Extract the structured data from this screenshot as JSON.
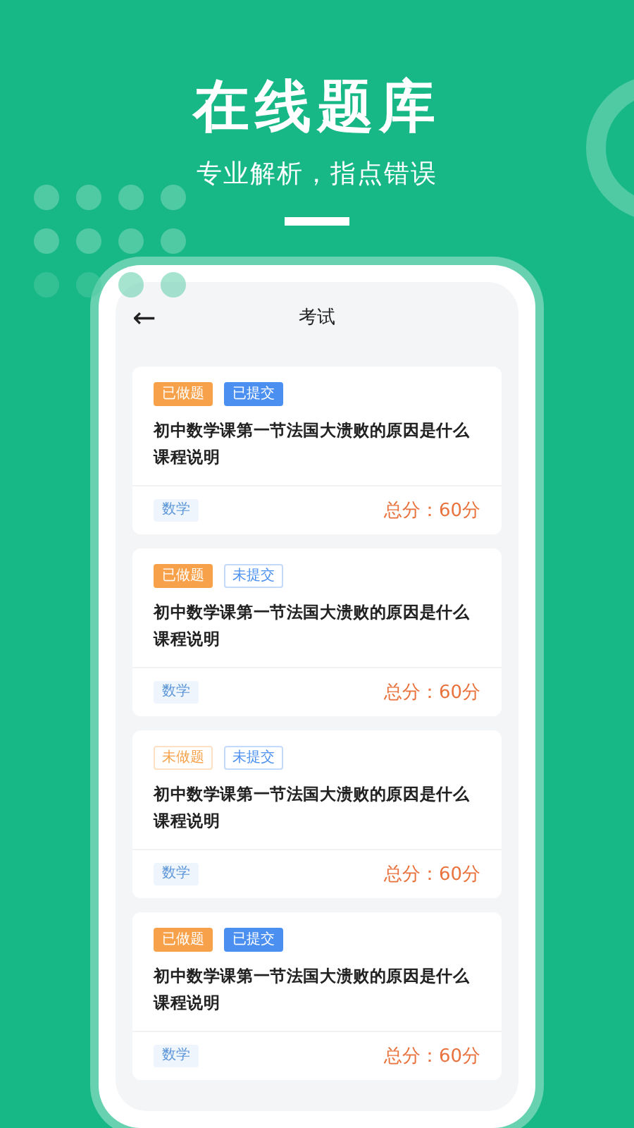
{
  "banner": {
    "title": "在线题库",
    "subtitle": "专业解析，指点错误"
  },
  "screen": {
    "header": {
      "back": "←",
      "title": "考试"
    },
    "cards": [
      {
        "tags": [
          {
            "label": "已做题",
            "color": "#f7a24b",
            "filled": true
          },
          {
            "label": "已提交",
            "color": "#4b90f0",
            "filled": true
          }
        ],
        "title": "初中数学课第一节法国大溃败的原因是什么",
        "description": "课程说明",
        "subject": "数学",
        "score": "总分：60分"
      },
      {
        "tags": [
          {
            "label": "已做题",
            "color": "#f7a24b",
            "filled": true
          },
          {
            "label": "未提交",
            "color": "#4b90f0",
            "filled": false
          }
        ],
        "title": "初中数学课第一节法国大溃败的原因是什么",
        "description": "课程说明",
        "subject": "数学",
        "score": "总分：60分"
      },
      {
        "tags": [
          {
            "label": "未做题",
            "color": "#f7a24b",
            "filled": false
          },
          {
            "label": "未提交",
            "color": "#4b90f0",
            "filled": false
          }
        ],
        "title": "初中数学课第一节法国大溃败的原因是什么",
        "description": "课程说明",
        "subject": "数学",
        "score": "总分：60分"
      },
      {
        "tags": [
          {
            "label": "已做题",
            "color": "#f7a24b",
            "filled": true
          },
          {
            "label": "已提交",
            "color": "#4b90f0",
            "filled": true
          }
        ],
        "title": "初中数学课第一节法国大溃败的原因是什么",
        "description": "课程说明",
        "subject": "数学",
        "score": "总分：60分"
      }
    ]
  }
}
